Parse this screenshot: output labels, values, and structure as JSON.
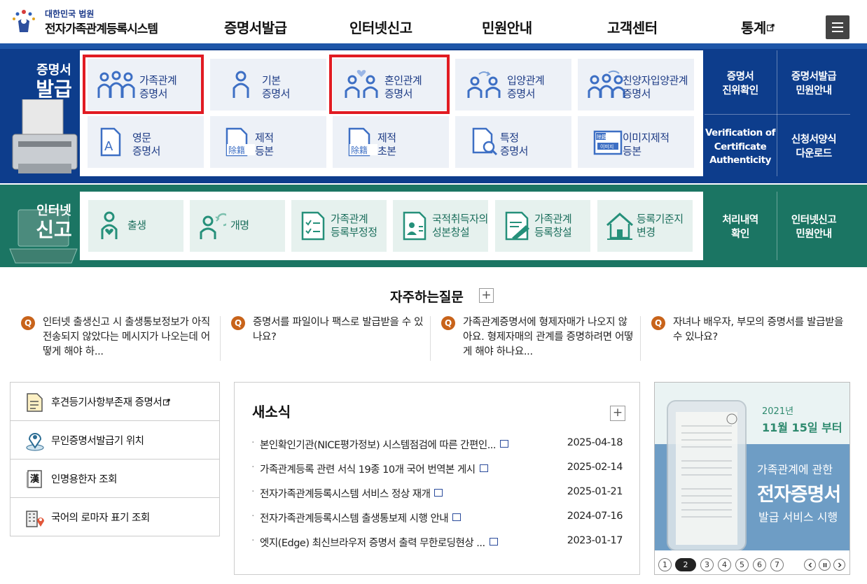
{
  "header": {
    "org": "대한민국 법원",
    "site_title": "전자가족관계등록시스템",
    "nav": [
      "증명서발급",
      "인터넷신고",
      "민원안내",
      "고객센터",
      "통계"
    ]
  },
  "certificate": {
    "label_small": "증명서",
    "label_large": "발급",
    "tiles": [
      {
        "line1": "가족관계",
        "line2": "증명서",
        "icon": "family-icon"
      },
      {
        "line1": "기본",
        "line2": "증명서",
        "icon": "person-icon"
      },
      {
        "line1": "혼인관계",
        "line2": "증명서",
        "icon": "marriage-icon"
      },
      {
        "line1": "입양관계",
        "line2": "증명서",
        "icon": "adoption-icon"
      },
      {
        "line1": "친양자입양관계",
        "line2": "증명서",
        "icon": "full-adoption-icon"
      },
      {
        "line1": "영문",
        "line2": "증명서",
        "icon": "english-doc-icon"
      },
      {
        "line1": "제적",
        "line2": "등본",
        "icon": "register-doc-icon"
      },
      {
        "line1": "제적",
        "line2": "초본",
        "icon": "register-extract-icon"
      },
      {
        "line1": "특정",
        "line2": "증명서",
        "icon": "search-doc-icon"
      },
      {
        "line1": "이미지제적",
        "line2": "등본",
        "icon": "image-doc-icon"
      }
    ],
    "side": [
      {
        "line1": "증명서",
        "line2": "진위확인"
      },
      {
        "line1": "증명서발급",
        "line2": "민원안내"
      },
      {
        "line1": "Verification of",
        "line2": "Certificate",
        "line3": "Authenticity"
      },
      {
        "line1": "신청서양식",
        "line2": "다운로드"
      }
    ],
    "icon_texts": {
      "doc_a": "A",
      "chars": "除籍",
      "img_top": "除籍",
      "img_label": "이미지"
    }
  },
  "report": {
    "label_small": "인터넷",
    "label_large": "신고",
    "tiles": [
      {
        "line1": "출생",
        "line2": "",
        "icon": "birth-icon"
      },
      {
        "line1": "개명",
        "line2": "",
        "icon": "rename-icon"
      },
      {
        "line1": "가족관계",
        "line2": "등록부정정",
        "icon": "checklist-icon"
      },
      {
        "line1": "국적취득자의",
        "line2": "성본창설",
        "icon": "id-card-icon"
      },
      {
        "line1": "가족관계",
        "line2": "등록창설",
        "icon": "pen-doc-icon"
      },
      {
        "line1": "등록기준지",
        "line2": "변경",
        "icon": "house-icon"
      }
    ],
    "side": [
      {
        "line1": "처리내역",
        "line2": "확인"
      },
      {
        "line1": "인터넷신고",
        "line2": "민원안내"
      }
    ]
  },
  "faq": {
    "title": "자주하는질문",
    "plus": "+",
    "q_mark": "Q",
    "items": [
      "인터넷 출생신고 시 출생통보정보가 아직 전송되지 않았다는 메시지가 나오는데 어떻게 해야 하...",
      "증명서를 파일이나 팩스로 발급받을 수 있나요?",
      "가족관계증명서에 형제자매가 나오지 않아요. 형제자매의 관계를 증명하려면 어떻게 해야 하나요...",
      "자녀나 배우자, 부모의 증명서를 발급받을 수 있나요?"
    ]
  },
  "quick_links": [
    {
      "label": "후견등기사항부존재 증명서",
      "icon": "document-icon"
    },
    {
      "label": "무인증명서발급기 위치",
      "icon": "location-pin-icon"
    },
    {
      "label": "인명용한자 조회",
      "icon": "hanja-book-icon"
    },
    {
      "label": "국어의 로마자 표기 조회",
      "icon": "building-pin-icon"
    }
  ],
  "news": {
    "title": "새소식",
    "plus": "+",
    "items": [
      {
        "title": "본인확인기관(NICE평가정보) 시스템점검에 따른 간편인...",
        "date": "2025-04-18"
      },
      {
        "title": "가족관계등록 관련 서식 19종 10개 국어 번역본 게시",
        "date": "2025-02-14"
      },
      {
        "title": "전자가족관계등록시스템 서비스 정상 재개",
        "date": "2025-01-21"
      },
      {
        "title": "전자가족관계등록시스템 출생통보제 시행 안내",
        "date": "2024-07-16"
      },
      {
        "title": "엣지(Edge) 최신브라우저 증명서 출력 무한로딩현상 ...",
        "date": "2023-01-17"
      }
    ]
  },
  "banner": {
    "year": "2021년",
    "date": "11월 15일 부터",
    "line1": "가족관계에 관한",
    "line2": "전자증명서",
    "line3": "발급 서비스 시행",
    "pages": [
      "1",
      "2",
      "3",
      "4",
      "5",
      "6",
      "7"
    ],
    "active_page": 2
  },
  "colors": {
    "blue_band": "#0d3d8c",
    "green_band": "#1b7563",
    "highlight": "#e11b22",
    "faq_q": "#c8631a"
  }
}
